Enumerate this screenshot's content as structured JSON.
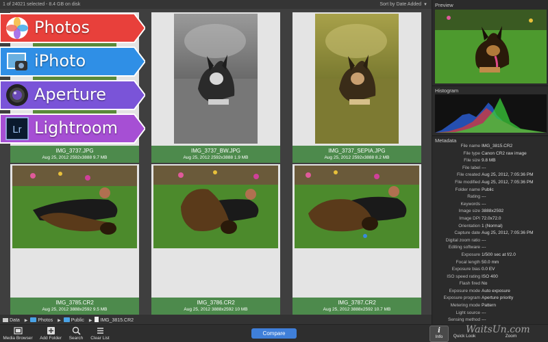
{
  "topbar": {
    "status": "1 of 24021 selected - 8.4 GB on disk",
    "sort": "Sort by Date Added"
  },
  "banners": [
    {
      "label": "Photos",
      "icon": "photos-icon",
      "color": "#e8403b"
    },
    {
      "label": "iPhoto",
      "icon": "iphoto-icon",
      "color": "#2f8fe6"
    },
    {
      "label": "Aperture",
      "icon": "aperture-icon",
      "color": "#7a54d8"
    },
    {
      "label": "Lightroom",
      "icon": "lightroom-icon",
      "color": "#a64fd4"
    }
  ],
  "lightroom_icon_text": "Lr",
  "cards": [
    {
      "name": "IMG_3737.JPG",
      "meta": "Aug 25, 2012   2592x3888   9.7 MB"
    },
    {
      "name": "IMG_3737_BW.JPG",
      "meta": "Aug 25, 2012   2592x3888   1.9 MB"
    },
    {
      "name": "IMG_3737_SEPIA.JPG",
      "meta": "Aug 25, 2012   2592x3888   8.2 MB"
    },
    {
      "name": "IMG_3785.CR2",
      "meta": "Aug 25, 2012   3888x2592   9.5 MB"
    },
    {
      "name": "IMG_3786.CR2",
      "meta": "Aug 25, 2012   3888x2592   10 MB"
    },
    {
      "name": "IMG_3787.CR2",
      "meta": "Aug 25, 2012   3888x2592   10.7 MB"
    }
  ],
  "breadcrumb": [
    "Data",
    "Photos",
    "Public",
    "IMG_3815.CR2"
  ],
  "toolbar": {
    "media_browser": "Media Browser",
    "add_folder": "Add Folder",
    "search": "Search",
    "clear_list": "Clear List",
    "compare": "Compare",
    "info": "Info",
    "quick_look": "Quick Look",
    "zoom": "Zoom"
  },
  "watermark": "WaitsUn.com",
  "panel": {
    "preview_title": "Preview",
    "histogram_title": "Histogram",
    "metadata_title": "Metadata",
    "metadata": [
      {
        "k": "File name",
        "v": "IMG_3815.CR2"
      },
      {
        "k": "File type",
        "v": "Canon CR2 raw image"
      },
      {
        "k": "File size",
        "v": "9.8 MB"
      },
      {
        "k": "File label",
        "v": "---"
      },
      {
        "k": "File created",
        "v": "Aug 25, 2012, 7:05:36 PM"
      },
      {
        "k": "File modified",
        "v": "Aug 25, 2012, 7:05:36 PM"
      },
      {
        "k": "Folder name",
        "v": "Public"
      },
      {
        "k": "Rating",
        "v": "---"
      },
      {
        "k": "Keywords",
        "v": "---"
      },
      {
        "k": "Image size",
        "v": "3888x2592"
      },
      {
        "k": "Image DPI",
        "v": "72.0x72.0"
      },
      {
        "k": "Orientation",
        "v": "1 (Normal)"
      },
      {
        "k": "Capture date",
        "v": "Aug 25, 2012, 7:05:36 PM"
      },
      {
        "k": "Digital zoom ratio",
        "v": "---"
      },
      {
        "k": "Editing software",
        "v": "---"
      },
      {
        "k": "Exposure",
        "v": "1/500 sec at f/2.0"
      },
      {
        "k": "Focal length",
        "v": "50.0 mm"
      },
      {
        "k": "Exposure bias",
        "v": "0.0 EV"
      },
      {
        "k": "ISO speed rating",
        "v": "ISO 400"
      },
      {
        "k": "Flash fired",
        "v": "No"
      },
      {
        "k": "Exposure mode",
        "v": "Auto exposure"
      },
      {
        "k": "Exposure program",
        "v": "Aperture priority"
      },
      {
        "k": "Metering mode",
        "v": "Pattern"
      },
      {
        "k": "Light source",
        "v": "---"
      },
      {
        "k": "Sensing method",
        "v": "---"
      }
    ]
  }
}
